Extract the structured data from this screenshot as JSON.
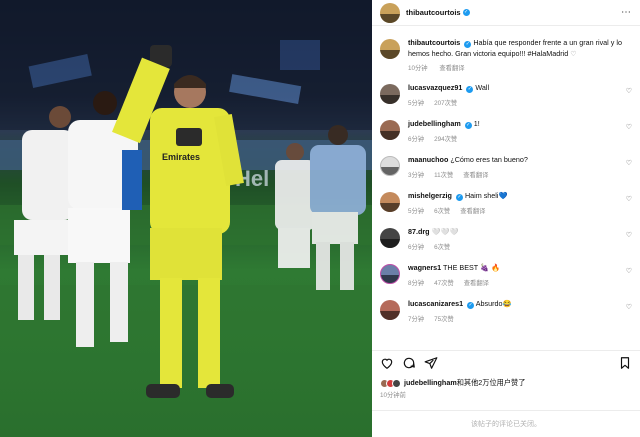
{
  "post": {
    "author": "thibautcourtois",
    "more_icon": "ellipsis-icon",
    "caption_user": "thibautcourtois",
    "caption_text": "Había que responder frente a un gran rival y lo hemos hecho. Gran victoria equipo!!! #HalaMadrid",
    "caption_time": "10分钟",
    "caption_translate": "查看翻译"
  },
  "comments": [
    {
      "user": "lucasvazquez91",
      "text": "Wall",
      "time": "5分钟",
      "likes": "207次赞"
    },
    {
      "user": "judebellingham",
      "text": "1!",
      "time": "6分钟",
      "likes": "294次赞"
    },
    {
      "user": "maanuchoo",
      "text": "¿Cómo eres tan bueno?",
      "time": "3分钟",
      "likes": "11次赞",
      "translate": "查看翻译"
    },
    {
      "user": "mishelgerzig",
      "text": "Haim sheli💙",
      "time": "5分钟",
      "likes": "6次赞",
      "translate": "查看翻译"
    },
    {
      "user": "87.drg",
      "text": "🤍🤍🤍",
      "time": "6分钟",
      "likes": "6次赞"
    },
    {
      "user": "wagners1",
      "text": "THE BEST 🍇 🔥",
      "time": "8分钟",
      "likes": "47次赞",
      "translate": "查看翻译"
    },
    {
      "user": "lucascanizares1",
      "text": "Absurdo😂",
      "time": "7分钟",
      "likes": "75次赞"
    }
  ],
  "likes": {
    "user": "judebellingham",
    "text": "和其他2万位用户赞了"
  },
  "post_time": "10分钟前",
  "footer_text": "该帖子的评论已关闭。",
  "colors": {
    "verified": "#1d9bf0",
    "kit_yellow": "#e4e63a",
    "pitch": "#2f7a33"
  }
}
